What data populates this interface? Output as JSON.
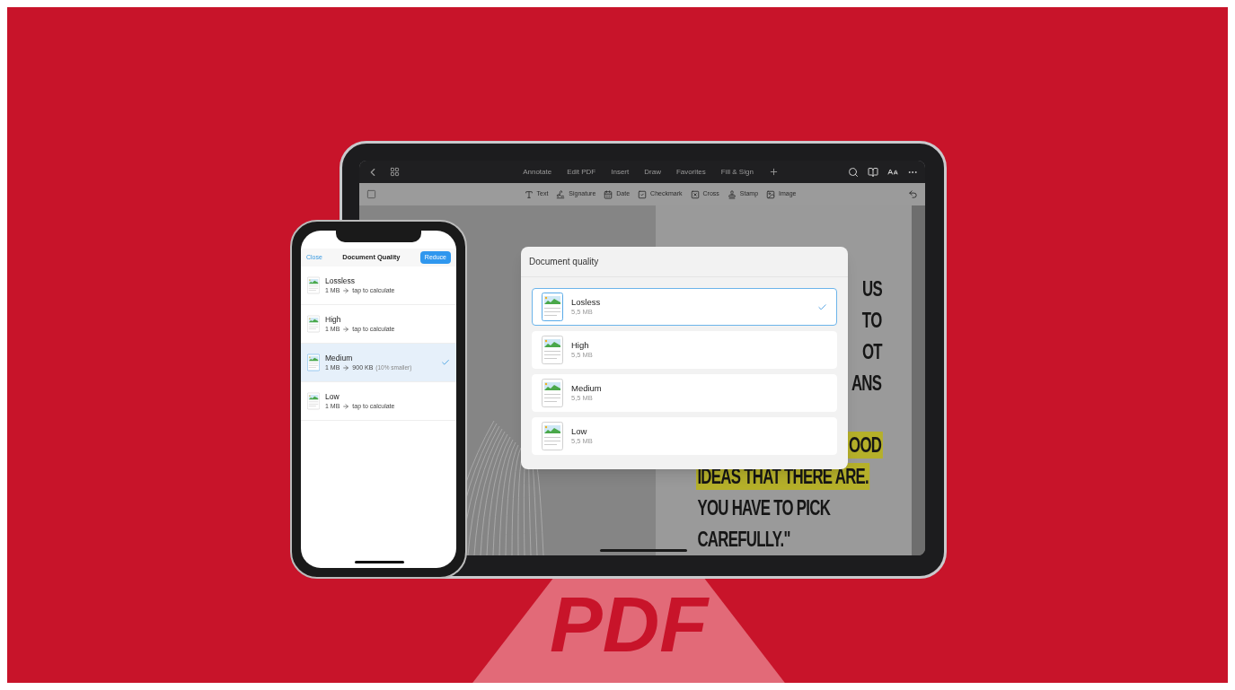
{
  "ipad": {
    "tabs": [
      "Annotate",
      "Edit PDF",
      "Insert",
      "Draw",
      "Favorites",
      "Fill & Sign"
    ],
    "tools": [
      {
        "kind": "text",
        "label": "Text"
      },
      {
        "kind": "signature",
        "label": "Signature"
      },
      {
        "kind": "date",
        "label": "Date"
      },
      {
        "kind": "checkmark",
        "label": "Checkmark"
      },
      {
        "kind": "cross",
        "label": "Cross"
      },
      {
        "kind": "stamp",
        "label": "Stamp"
      },
      {
        "kind": "image",
        "label": "Image"
      }
    ],
    "poster": [
      {
        "lines": [
          {
            "text": "US",
            "highlighted": false,
            "clipped": true
          },
          {
            "text": "TO",
            "highlighted": false,
            "clipped": true
          },
          {
            "text": "OT",
            "highlighted": false,
            "clipped": true
          },
          {
            "text": "ANS",
            "highlighted": false,
            "clipped": true
          }
        ]
      },
      {
        "lines": [
          {
            "text": "OOD",
            "highlighted": true,
            "clipped": true
          },
          {
            "text": "IDEAS THAT THERE ARE.",
            "highlighted": true,
            "clipped": false
          },
          {
            "text": "YOU HAVE TO PICK",
            "highlighted": false,
            "clipped": false
          },
          {
            "text": "CAREFULLY.\"",
            "highlighted": false,
            "clipped": false
          }
        ]
      }
    ],
    "dialog": {
      "title": "Document quality",
      "options": [
        {
          "name": "Losless",
          "size": "5,5 MB",
          "selected": true
        },
        {
          "name": "High",
          "size": "5,5 MB",
          "selected": false
        },
        {
          "name": "Medium",
          "size": "5,5 MB",
          "selected": false
        },
        {
          "name": "Low",
          "size": "5,5 MB",
          "selected": false
        }
      ]
    }
  },
  "phone": {
    "close": "Close",
    "title": "Document Quality",
    "reduce": "Reduce",
    "options": [
      {
        "name": "Lossless",
        "original": "1 MB",
        "result": "tap to calculate",
        "selected": false
      },
      {
        "name": "High",
        "original": "1 MB",
        "result": "tap to calculate",
        "selected": false
      },
      {
        "name": "Medium",
        "original": "1 MB",
        "result": "900 KB",
        "note": "(10% smaller)",
        "selected": true
      },
      {
        "name": "Low",
        "original": "1 MB",
        "result": "tap to calculate",
        "selected": false
      }
    ]
  },
  "banner": {
    "text": "PDF"
  }
}
